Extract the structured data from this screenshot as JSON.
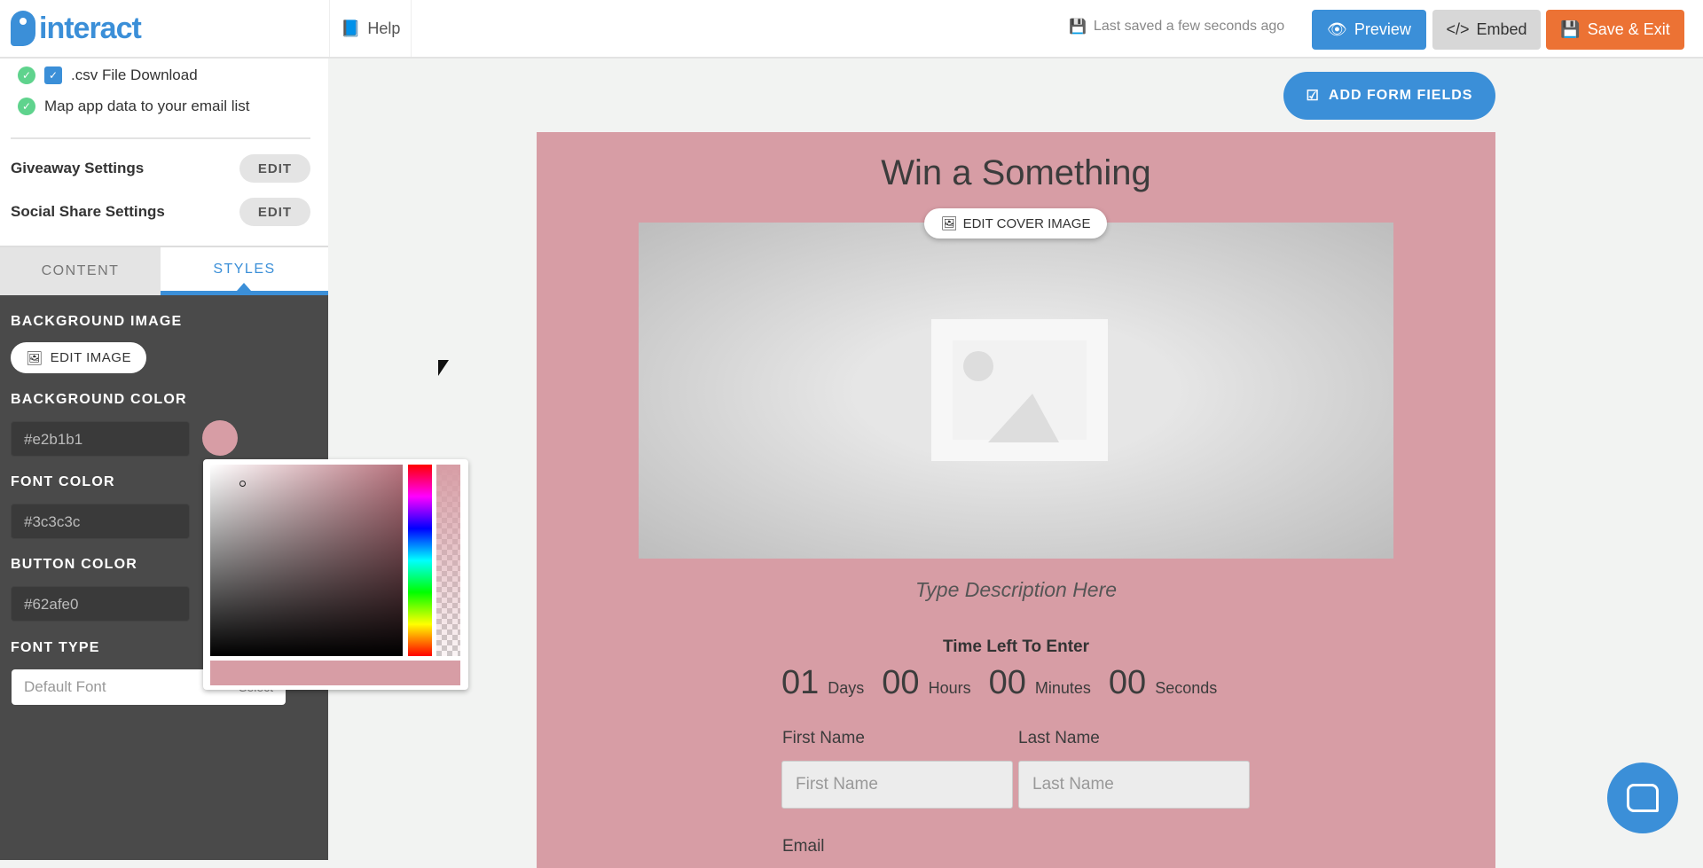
{
  "header": {
    "logo": "interact",
    "help": "Help",
    "saved": "Last saved a few seconds ago",
    "preview": "Preview",
    "embed": "Embed",
    "save_exit": "Save & Exit"
  },
  "colors": {
    "brand": "#3b8fd8",
    "save": "#ec7234",
    "embed": "#d7d7d7",
    "card_bg": "#d79da5"
  },
  "panel": {
    "checks": [
      {
        "label": ".csv File Download"
      },
      {
        "label": "Map app data to your email list"
      }
    ],
    "settings": [
      {
        "label": "Giveaway Settings",
        "button": "EDIT"
      },
      {
        "label": "Social Share Settings",
        "button": "EDIT"
      }
    ],
    "tabs": [
      {
        "label": "CONTENT"
      },
      {
        "label": "STYLES",
        "active": true
      }
    ],
    "styles": {
      "bg_image_label": "BACKGROUND IMAGE",
      "edit_image": "EDIT IMAGE",
      "bg_color_label": "BACKGROUND COLOR",
      "bg_color": "#e2b1b1",
      "font_color_label": "FONT COLOR",
      "font_color": "#3c3c3c",
      "button_color_label": "BUTTON COLOR",
      "button_color": "#62afe0",
      "font_type_label": "FONT TYPE",
      "font_type_placeholder": "Default Font",
      "font_select": "Select"
    }
  },
  "canvas": {
    "add_fields": "ADD FORM FIELDS",
    "title": "Win a Something",
    "edit_cover": "EDIT COVER IMAGE",
    "description": "Type Description Here",
    "timer_title": "Time Left To Enter",
    "countdown": [
      {
        "num": "01",
        "unit": "Days"
      },
      {
        "num": "00",
        "unit": "Hours"
      },
      {
        "num": "00",
        "unit": "Minutes"
      },
      {
        "num": "00",
        "unit": "Seconds"
      }
    ],
    "first_label": "First Name",
    "first_ph": "First Name",
    "last_label": "Last Name",
    "last_ph": "Last Name",
    "email_label": "Email"
  }
}
